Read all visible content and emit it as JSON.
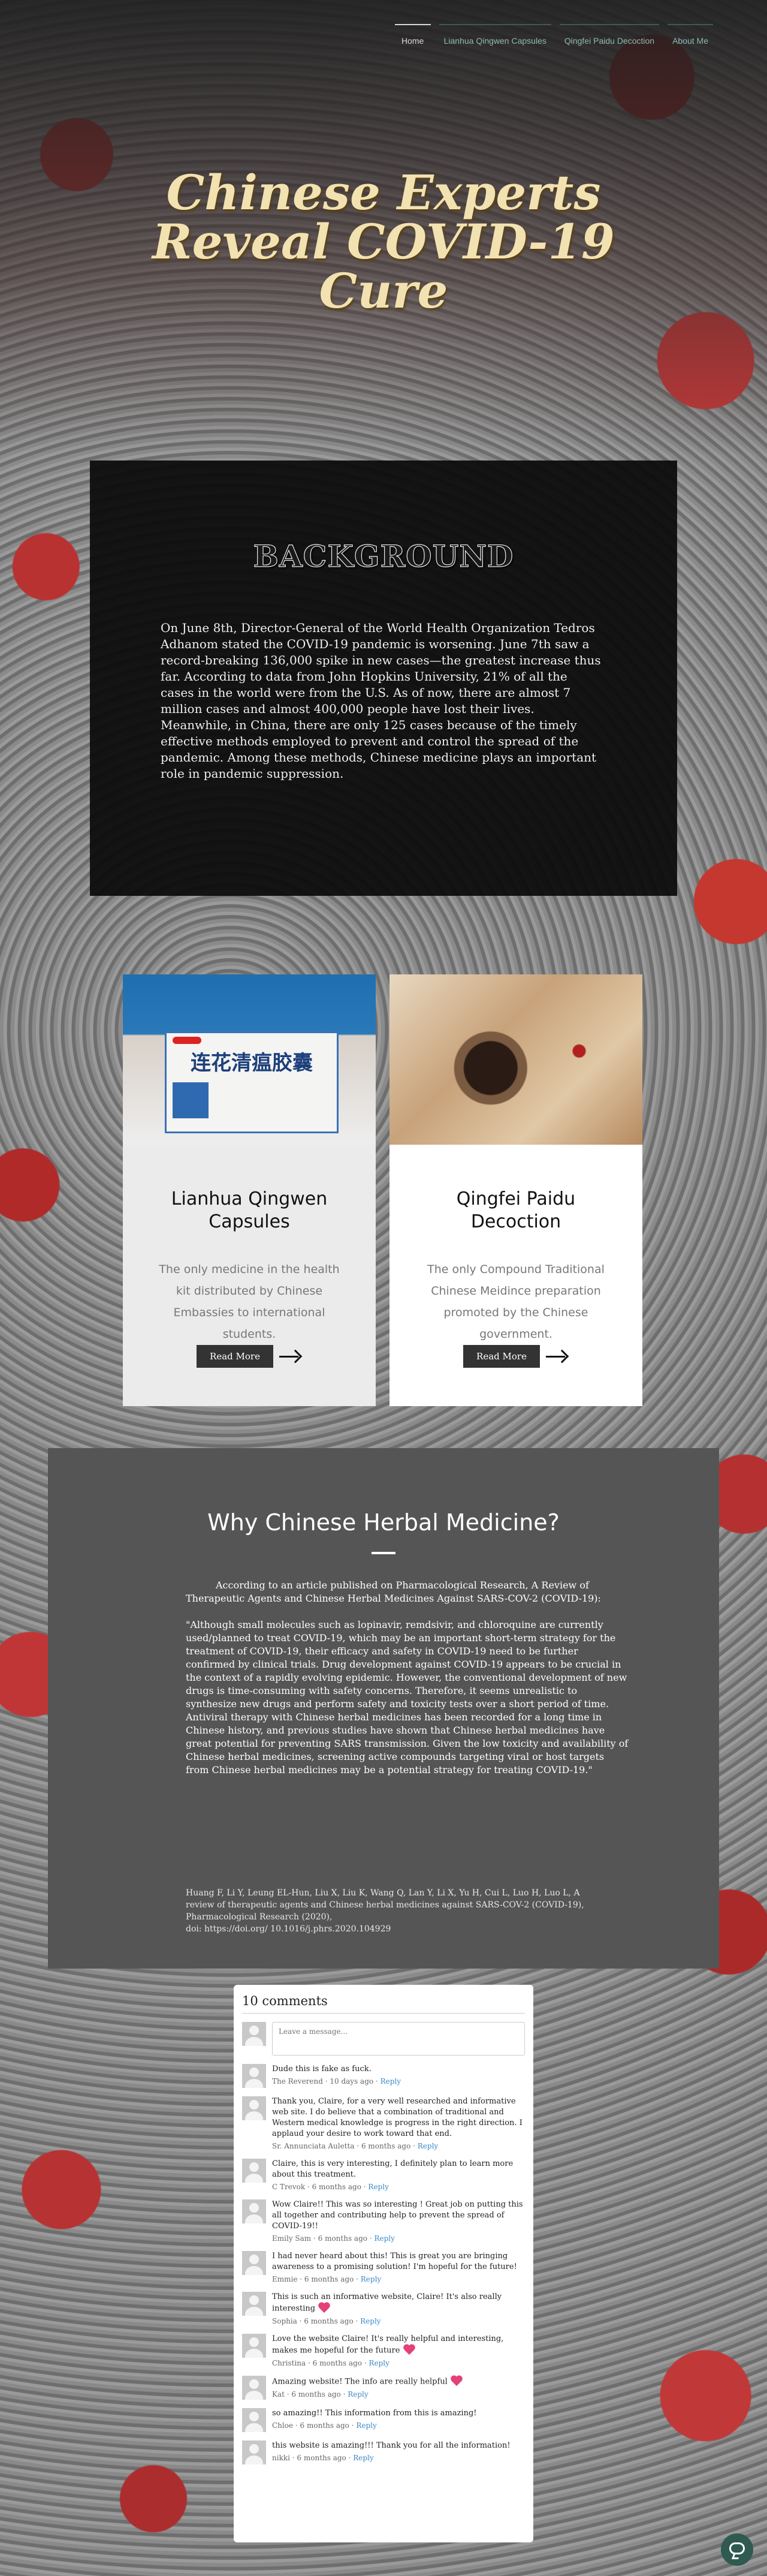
{
  "nav": {
    "items": [
      "Home",
      "Lianhua Qingwen Capsules",
      "Qingfei Paidu Decoction",
      "About Me"
    ],
    "active": "Home"
  },
  "hero": {
    "title": "Chinese Experts Reveal COVID-19 Cure"
  },
  "background": {
    "title": "BACKGROUND",
    "text": "On June 8th,  Director-General of the World Health Organization Tedros Adhanom stated the COVID-19 pandemic is worsening. June 7th saw a record-breaking 136,000 spike in new cases—the greatest increase thus far.  According to data from John Hopkins University,  21% of all the cases in the world were from the U.S. As of now, there are almost 7 million cases and almost 400,000 people have lost their lives. Meanwhile, in China, there are only 125 cases because of the timely effective methods employed to prevent and control the spread of the pandemic. Among these methods, Chinese medicine plays an important role in pandemic suppression."
  },
  "cards": [
    {
      "title": "Lianhua Qingwen Capsules",
      "description": "The only medicine in the health kit distributed by Chinese Embassies to international students.",
      "button": "Read More",
      "image_text": "连花清瘟胶囊"
    },
    {
      "title": "Qingfei Paidu Decoction",
      "description": "The only Compound Traditional Chinese Meidince preparation promoted by the Chinese government.",
      "button": "Read More"
    }
  ],
  "why": {
    "title": "Why Chinese Herbal Medicine?",
    "intro": "According to an article published on Pharmacological Research, A Review of Therapeutic Agents and Chinese Herbal Medicines Against SARS-COV-2 (COVID-19):",
    "quote": "\"Although small molecules such as lopinavir, remdsivir, and chloroquine are currently used/planned to treat COVID-19, which may be an important short-term strategy for the treatment of COVID-19, their efficacy and safety in COVID-19 need to be further confirmed by clinical trials. Drug development against COVID-19 appears to be crucial in the context of a rapidly evolving epidemic. However, the conventional development of new drugs is time-consuming with safety concerns. Therefore, it seems unrealistic to synthesize new drugs and perform safety and toxicity tests over a short period of time. Antiviral therapy with Chinese herbal medicines has been recorded for a long time in Chinese history, and previous studies have shown that Chinese herbal medicines have great potential for preventing SARS transmission. Given the low toxicity and availability of Chinese herbal medicines, screening active compounds targeting viral or host targets from Chinese herbal medicines may be a potential strategy for treating COVID-19.\"",
    "reference": "Huang F, Li Y, Leung EL-Hun, Liu X, Liu K, Wang Q, Lan Y, Li X, Yu H, Cui L, Luo H, Luo L, A review of therapeutic agents and Chinese herbal medicines against SARS-COV-2 (COVID-19), Pharmacological Research (2020),",
    "doi": "doi: https://doi.org/ 10.1016/j.phrs.2020.104929"
  },
  "comments": {
    "count_label": "10 comments",
    "placeholder": "Leave a message...",
    "reply_label": "Reply",
    "items": [
      {
        "text": "Dude this is fake as fuck.",
        "author": "The Reverend",
        "time": "10 days ago"
      },
      {
        "text": "Thank you, Claire, for a very well researched and informative web site. I do believe that a combination of traditional and Western medical knowledge is progress in the right direction. I applaud your desire to work toward that end.",
        "author": "Sr. Annunciata Auletta",
        "time": "6 months ago"
      },
      {
        "text": "Claire, this is very interesting, I definitely plan to learn more about this treatment.",
        "author": "C Trevok",
        "time": "6 months ago"
      },
      {
        "text": "Wow Claire!! This was so interesting ! Great job on putting this all together and contributing help to prevent the spread of COVID-19!!",
        "author": "Emily Sam",
        "time": "6 months ago"
      },
      {
        "text": "I had never heard about this! This is great you are bringing awareness to a promising solution! I'm hopeful for the future!",
        "author": "Emmie",
        "time": "6 months ago"
      },
      {
        "text": "This is such an informative website, Claire! It's also really interesting",
        "author": "Sophia",
        "time": "6 months ago",
        "heart": true
      },
      {
        "text": "Love the website Claire! It's really helpful and interesting, makes me hopeful for the future",
        "author": "Christina",
        "time": "6 months ago",
        "heart": true
      },
      {
        "text": "Amazing website! The info are really helpful",
        "author": "Kat",
        "time": "6 months ago",
        "heart": true
      },
      {
        "text": "so amazing!! This information from this is amazing!",
        "author": "Chloe",
        "time": "6 months ago"
      },
      {
        "text": "this website is amazing!!! Thank you for all the information!",
        "author": "nikki",
        "time": "6 months ago"
      }
    ]
  },
  "colors": {
    "nav_text": "#8fb9b2",
    "hero_title": "#f2e2b2",
    "reply_link": "#3a88c8",
    "heart": "#e4407a"
  }
}
